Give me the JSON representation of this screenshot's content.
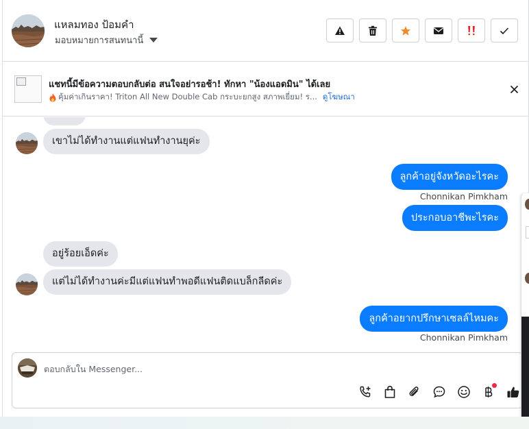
{
  "header": {
    "name": "แหลมทอง ป้อมคำ",
    "assign_label": "มอบหมายการสนทนานี้"
  },
  "ad": {
    "title": "แชทนี้มีข้อความตอบกลับต่อ สนใจอย่ารอช้า! ทักหา \"น้องแอดมิน\" ได้เลย",
    "subtitle": "คุ้มค่าเกินราคา! Triton All New Double Cab กระบะยกสูง สภาพเยี่ยม! ร...",
    "link": "ดูโฆษณา"
  },
  "messages": [
    {
      "direction": "in",
      "text": "เขาไม่ได้ทำงานแต่แฟนทำงานยุค่ะ"
    },
    {
      "direction": "out",
      "text": "ลูกค้าอยู่จังหวัดอะไรคะ",
      "sender": "Chonnikan Pimkham"
    },
    {
      "direction": "out",
      "text": "ประกอบอาชีพะไรคะ"
    },
    {
      "direction": "in",
      "text": "อยู่ร้อยเอ็ดค่ะ"
    },
    {
      "direction": "in",
      "text": "แต่ไม่ได้ทำงานค่ะมีแต่แฟนทำพอดีแฟนติดแบล็กลีดค่ะ"
    },
    {
      "direction": "out",
      "text": "ลูกค้าอยากปรึกษาเซลล์ไหมคะ",
      "sender": "Chonnikan Pimkham"
    }
  ],
  "composer": {
    "placeholder": "ตอบกลับใน Messenger..."
  },
  "icons": {
    "header_actions": [
      "warning-icon",
      "trash-icon",
      "star-icon",
      "envelope-icon",
      "important-icon",
      "check-icon"
    ],
    "composer_tools": [
      "phone-plus-icon",
      "shopping-bag-icon",
      "paperclip-icon",
      "chat-bubble-icon",
      "emoji-icon",
      "baht-icon",
      "thumbs-up-icon"
    ]
  },
  "colors": {
    "outgoing_bubble": "#0a7cff",
    "incoming_bubble": "#e4e6eb",
    "star": "#f5882b",
    "important": "#e02424",
    "link": "#216fdb",
    "notification_dot": "#f02849"
  }
}
